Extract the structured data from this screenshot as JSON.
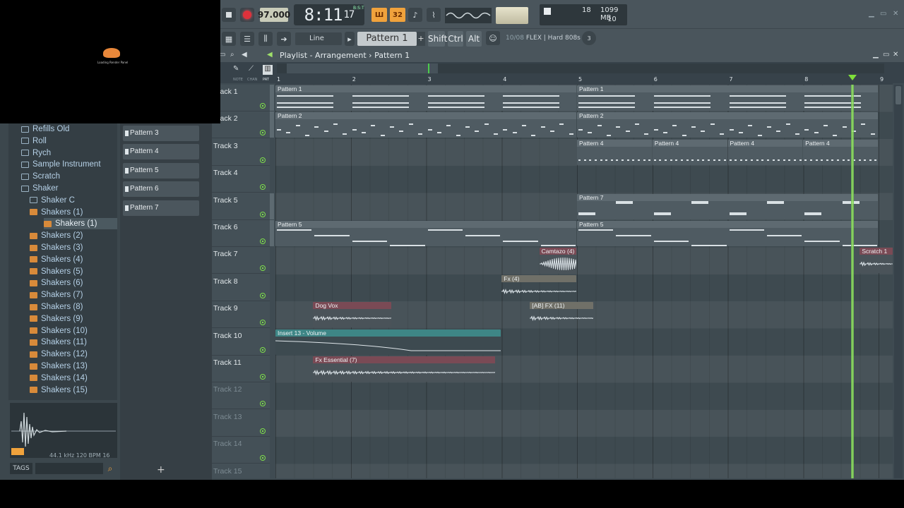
{
  "toolbar": {
    "tempo": "97.000",
    "time_main": "8:11",
    "time_sub": "17",
    "time_unit": "B:S:T",
    "pat_mode_label": "Ш",
    "step_label": "32",
    "cpu_value": "18",
    "memory": "1099 MB",
    "polyphony": "10",
    "snap": "Line",
    "pattern_selector": "Pattern 1",
    "pattern_add": "+",
    "shift_key": "Shift",
    "ctrl_key": "Ctrl",
    "alt_key": "Alt",
    "hint_count": "10/08",
    "hint_text": "FLEX | Hard 808s",
    "notification_count": "3"
  },
  "browser": {
    "items": [
      {
        "label": "Refills Old",
        "type": "folder"
      },
      {
        "label": "Roll",
        "type": "folder"
      },
      {
        "label": "Rych",
        "type": "folder"
      },
      {
        "label": "Sample Instrument",
        "type": "folder"
      },
      {
        "label": "Scratch",
        "type": "folder"
      },
      {
        "label": "Shaker",
        "type": "folder"
      },
      {
        "label": "Shaker C",
        "type": "folder"
      },
      {
        "label": "Shakers (1)",
        "type": "file"
      },
      {
        "label": "Shakers (1)",
        "type": "file"
      },
      {
        "label": "Shakers (2)",
        "type": "file"
      },
      {
        "label": "Shakers (3)",
        "type": "file"
      },
      {
        "label": "Shakers (4)",
        "type": "file"
      },
      {
        "label": "Shakers (5)",
        "type": "file"
      },
      {
        "label": "Shakers (6)",
        "type": "file"
      },
      {
        "label": "Shakers (7)",
        "type": "file"
      },
      {
        "label": "Shakers (8)",
        "type": "file"
      },
      {
        "label": "Shakers (9)",
        "type": "file"
      },
      {
        "label": "Shakers (10)",
        "type": "file"
      },
      {
        "label": "Shakers (11)",
        "type": "file"
      },
      {
        "label": "Shakers (12)",
        "type": "file"
      },
      {
        "label": "Shakers (13)",
        "type": "file"
      },
      {
        "label": "Shakers (14)",
        "type": "file"
      },
      {
        "label": "Shakers (15)",
        "type": "file"
      }
    ],
    "wave_info": "44.1 kHz 120 BPM 16",
    "tags_label": "TAGS"
  },
  "picker": {
    "items": [
      "Pattern 3",
      "Pattern 4",
      "Pattern 5",
      "Pattern 6",
      "Pattern 7"
    ],
    "add": "+"
  },
  "playlist": {
    "title": "Playlist - Arrangement",
    "breadcrumb_sep": "›",
    "current_pattern": "Pattern 1",
    "ruler": [
      "1",
      "2",
      "3",
      "4",
      "5",
      "6",
      "7",
      "8",
      "9"
    ],
    "header_tabs": [
      "NOTE",
      "CHAN",
      "PAT"
    ],
    "tracks": [
      "Track 1",
      "Track 2",
      "Track 3",
      "Track 4",
      "Track 5",
      "Track 6",
      "Track 7",
      "Track 8",
      "Track 9",
      "Track 10",
      "Track 11",
      "Track 12",
      "Track 13",
      "Track 14",
      "Track 15"
    ],
    "clips": [
      {
        "label": "Pattern 1",
        "kind": "pat",
        "track": 0,
        "start": 0,
        "len": 4
      },
      {
        "label": "Pattern 1",
        "kind": "pat",
        "track": 0,
        "start": 4,
        "len": 4
      },
      {
        "label": "Pattern 2",
        "kind": "pat",
        "track": 1,
        "start": 0,
        "len": 4
      },
      {
        "label": "Pattern 2",
        "kind": "pat",
        "track": 1,
        "start": 4,
        "len": 4
      },
      {
        "label": "Pattern 4",
        "kind": "pat",
        "track": 2,
        "start": 4,
        "len": 1
      },
      {
        "label": "Pattern 4",
        "kind": "pat",
        "track": 2,
        "start": 5,
        "len": 1
      },
      {
        "label": "Pattern 4",
        "kind": "pat",
        "track": 2,
        "start": 6,
        "len": 1
      },
      {
        "label": "Pattern 4",
        "kind": "pat",
        "track": 2,
        "start": 7,
        "len": 1
      },
      {
        "label": "Pattern 7",
        "kind": "pat",
        "track": 4,
        "start": 4,
        "len": 4
      },
      {
        "label": "Pattern 5",
        "kind": "pat",
        "track": 5,
        "start": 0,
        "len": 4
      },
      {
        "label": "Pattern 5",
        "kind": "pat",
        "track": 5,
        "start": 4,
        "len": 4
      },
      {
        "label": "Camtazo (4)",
        "kind": "audio",
        "track": 6,
        "start": 3.5,
        "len": 0.5
      },
      {
        "label": "Scratch 1",
        "kind": "audio",
        "track": 6,
        "start": 7.75,
        "len": 0.5
      },
      {
        "label": "Fx (4)",
        "kind": "fx",
        "track": 7,
        "start": 3,
        "len": 1
      },
      {
        "label": "Dog Vox",
        "kind": "audio",
        "track": 8,
        "start": 0.5,
        "len": 1.05
      },
      {
        "label": "[AB] FX (11)",
        "kind": "fx",
        "track": 8,
        "start": 3.375,
        "len": 0.85
      },
      {
        "label": "Insert 13 - Volume",
        "kind": "auto",
        "track": 9,
        "start": 0,
        "len": 3
      },
      {
        "label": "Fx Essential (7)",
        "kind": "audio",
        "track": 10,
        "start": 0.5,
        "len": 2.42
      }
    ],
    "song_position_bar": 7.65
  }
}
